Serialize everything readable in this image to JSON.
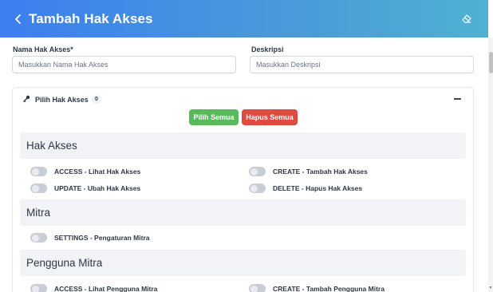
{
  "header": {
    "title": "Tambah Hak Akses",
    "back_icon": "chevron-left-icon",
    "clear_icon": "eraser-icon"
  },
  "form": {
    "name_label": "Nama Hak Akses*",
    "name_placeholder": "Masukkan Nama Hak Akses",
    "desc_label": "Deskripsi",
    "desc_placeholder": "Masukkan Deskripsi"
  },
  "permissions_card": {
    "title": "Pilih Hak Akses",
    "count": "0",
    "select_all_label": "Pilih Semua",
    "clear_all_label": "Hapus Semua",
    "colors": {
      "select_all": "#5cb85c",
      "clear_all": "#dd4b42",
      "toggle_off": "#c9ced6"
    }
  },
  "sections": [
    {
      "title": "Hak Akses",
      "items": [
        {
          "label": "ACCESS - Lihat Hak Akses",
          "enabled": false
        },
        {
          "label": "CREATE - Tambah Hak Akses",
          "enabled": false
        },
        {
          "label": "UPDATE - Ubah Hak Akses",
          "enabled": false
        },
        {
          "label": "DELETE - Hapus Hak Akses",
          "enabled": false
        }
      ]
    },
    {
      "title": "Mitra",
      "items": [
        {
          "label": "SETTINGS - Pengaturan Mitra",
          "enabled": false
        }
      ]
    },
    {
      "title": "Pengguna Mitra",
      "items": [
        {
          "label": "ACCESS - Lihat Pengguna Mitra",
          "enabled": false
        },
        {
          "label": "CREATE - Tambah Pengguna Mitra",
          "enabled": false
        }
      ]
    }
  ]
}
